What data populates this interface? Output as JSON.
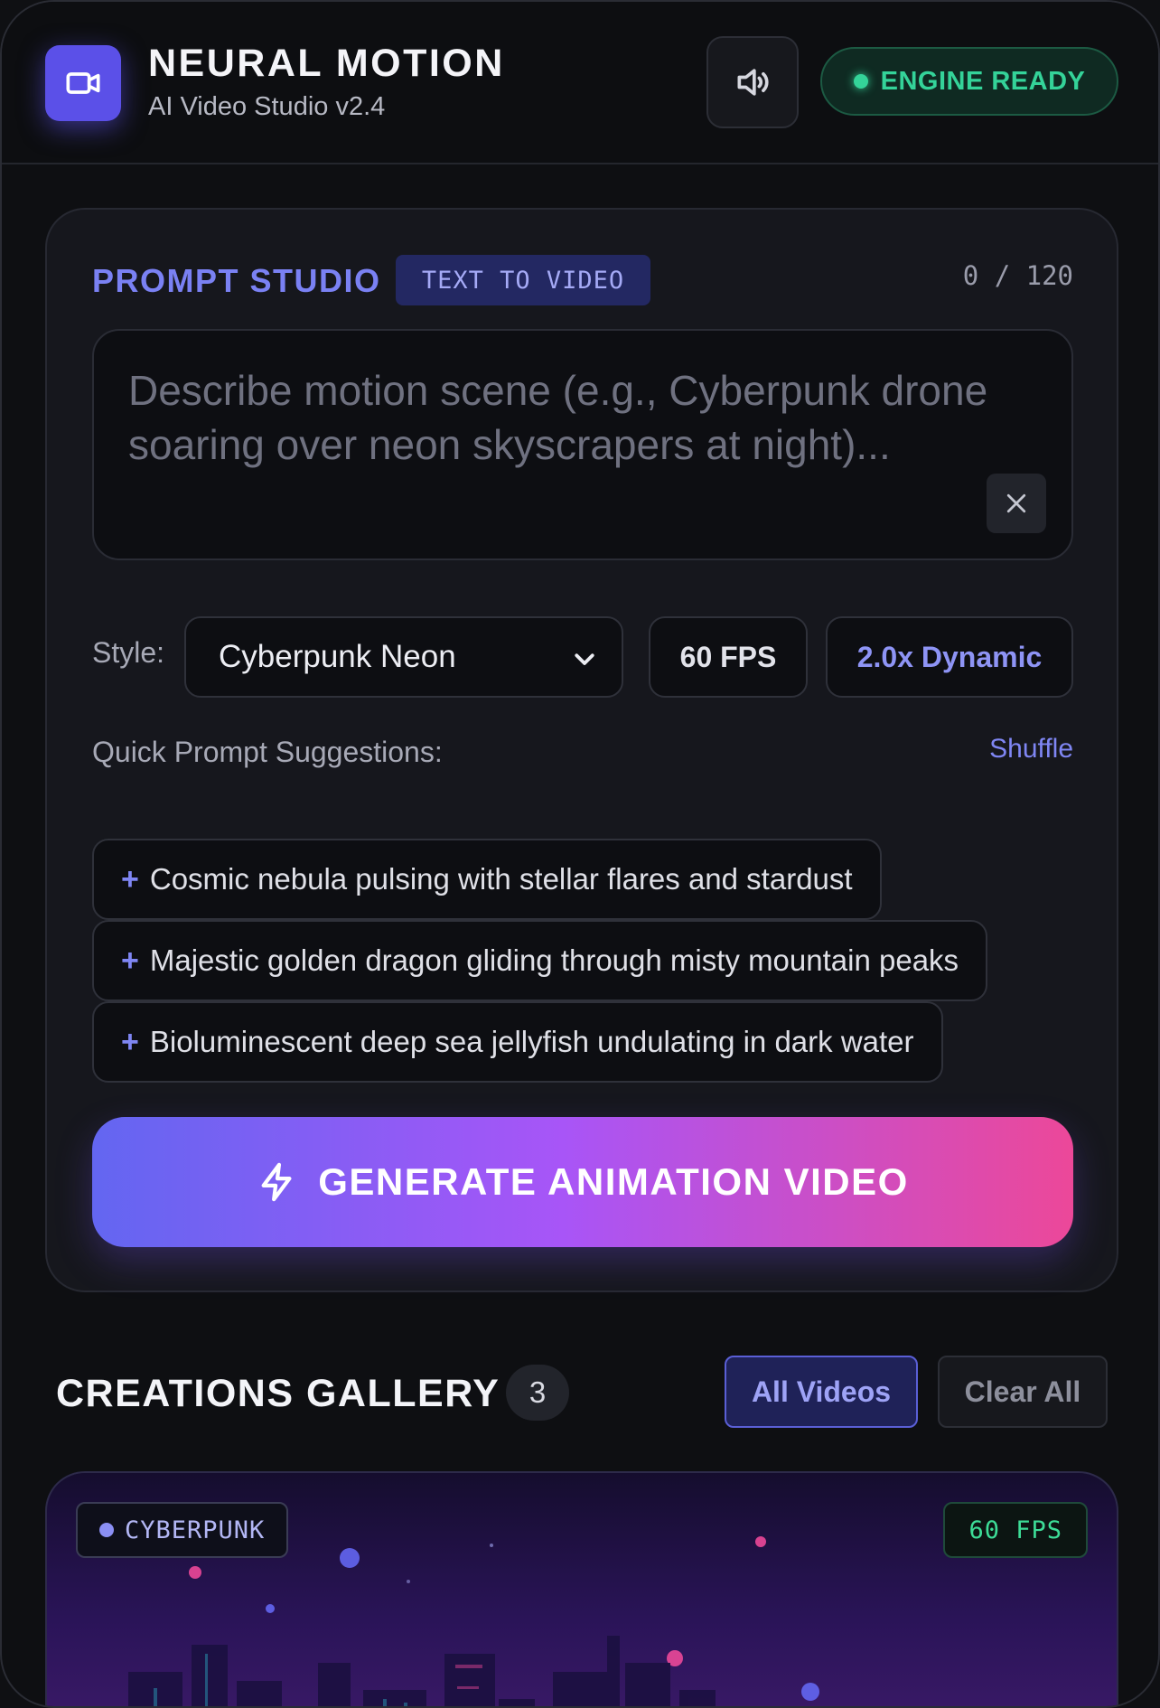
{
  "header": {
    "title": "NEURAL MOTION",
    "subtitle": "AI Video Studio v2.4",
    "status": "ENGINE READY",
    "logo_icon": "video-camera-icon",
    "sound_icon": "speaker-icon"
  },
  "prompt_studio": {
    "label": "PROMPT STUDIO",
    "mode": "TEXT TO VIDEO",
    "char_count": "0 / 120",
    "placeholder": "Describe motion scene (e.g., Cyberpunk drone soaring over neon skyscrapers at night)...",
    "value": "",
    "style_label": "Style:",
    "style_value": "Cyberpunk Neon",
    "fps": "60 FPS",
    "motion": "2.0x Dynamic",
    "suggestions_label": "Quick Prompt Suggestions:",
    "shuffle_label": "Shuffle",
    "suggestions": [
      "Cosmic nebula pulsing with stellar flares and stardust",
      "Majestic golden dragon gliding through misty mountain peaks",
      "Bioluminescent deep sea jellyfish undulating in dark water"
    ],
    "generate_label": "GENERATE ANIMATION VIDEO"
  },
  "gallery": {
    "title": "CREATIONS GALLERY",
    "count": "3",
    "filter_all": "All Videos",
    "clear_all": "Clear All",
    "items": [
      {
        "style_tag": "CYBERPUNK",
        "fps_tag": "60 FPS"
      }
    ]
  },
  "colors": {
    "accent": "#6366f1",
    "ready": "#34d399",
    "gradient_start": "#6366f1",
    "gradient_mid": "#a855f7",
    "gradient_end": "#ec4899"
  }
}
